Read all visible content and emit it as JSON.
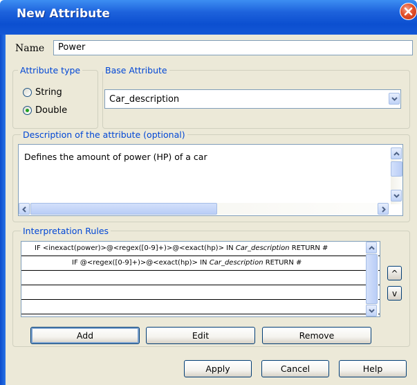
{
  "window": {
    "title": "New Attribute"
  },
  "name_field": {
    "label": "Name",
    "value": "Power"
  },
  "attribute_type": {
    "group_title": "Attribute type",
    "options": [
      "String",
      "Double"
    ],
    "selected": "Double"
  },
  "base_attribute": {
    "group_title": "Base Attribute",
    "value": "Car_description"
  },
  "description": {
    "group_title": "Description of the attribute (optional)",
    "text": "Defines the amount of power (HP) of a car"
  },
  "rules": {
    "group_title": "Interpretation Rules",
    "rows": [
      {
        "prefix": "IF <inexact(power)>@<regex([0-9]+)>@<exact(hp)> IN ",
        "source": "Car_description",
        "suffix": " RETURN #"
      },
      {
        "prefix": "IF @<regex([0-9]+)>@<exact(hp)> IN ",
        "source": "Car_description",
        "suffix": " RETURN #"
      },
      {
        "prefix": "",
        "source": "",
        "suffix": ""
      },
      {
        "prefix": "",
        "source": "",
        "suffix": ""
      },
      {
        "prefix": "",
        "source": "",
        "suffix": ""
      }
    ],
    "move_up_label": "^",
    "move_down_label": "v",
    "add_label": "Add",
    "edit_label": "Edit",
    "remove_label": "Remove"
  },
  "footer": {
    "apply_label": "Apply",
    "cancel_label": "Cancel",
    "help_label": "Help"
  },
  "colors": {
    "title_bar": "#1d62dc",
    "group_title": "#0046d5",
    "dialog_bg": "#ece9d8"
  },
  "icons": [
    "close-icon",
    "chevron-down-icon",
    "arrow-up-icon",
    "arrow-down-icon",
    "arrow-left-icon",
    "arrow-right-icon"
  ]
}
